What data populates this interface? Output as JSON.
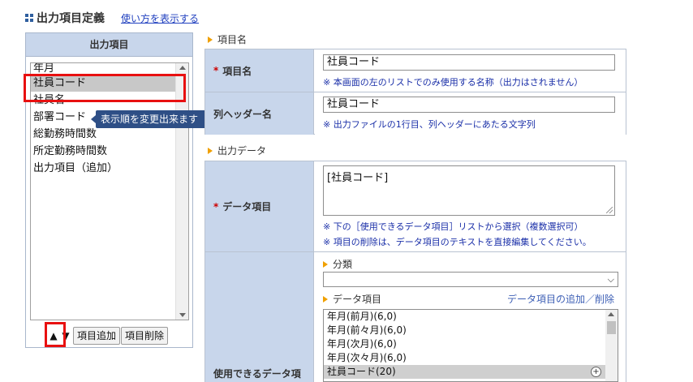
{
  "header": {
    "title": "出力項目定義",
    "help_link": "使い方を表示する"
  },
  "left_panel": {
    "heading": "出力項目",
    "items": [
      {
        "label": "年月"
      },
      {
        "label": "社員コード"
      },
      {
        "label": "社員名"
      },
      {
        "label": "部署コード"
      },
      {
        "label": "総勤務時間数"
      },
      {
        "label": "所定勤務時間数"
      },
      {
        "label": "出力項目（追加）"
      }
    ],
    "selected_index": 1,
    "tooltip": "表示順を変更出来ます",
    "up_arrow": "▲",
    "down_arrow": "▼",
    "add_button": "項目追加",
    "delete_button": "項目削除"
  },
  "section_item_name": {
    "label": "項目名"
  },
  "item_name_row": {
    "required": "*",
    "label": "項目名",
    "value": "社員コード",
    "note": "※ 本画面の左のリストでのみ使用する名称（出力はされません）"
  },
  "column_header_row": {
    "label": "列ヘッダー名",
    "value": "社員コード",
    "note": "※ 出力ファイルの1行目、列ヘッダーにあたる文字列"
  },
  "section_output_data": {
    "label": "出力データ"
  },
  "data_item_row": {
    "required": "*",
    "label": "データ項目",
    "value": "[社員コード]",
    "note1": "※ 下の［使用できるデータ項目］リストから選択（複数選択可）",
    "note2": "※ 項目の削除は、データ項目のテキストを直接編集してください。"
  },
  "available_row": {
    "label": "使用できるデータ項",
    "category_label": "分類",
    "category_value": "",
    "data_items_label": "データ項目",
    "add_delete_link": "データ項目の追加／削除",
    "data_items": [
      {
        "label": "年月(前月)(6,0)"
      },
      {
        "label": "年月(前々月)(6,0)"
      },
      {
        "label": "年月(次月)(6,0)"
      },
      {
        "label": "年月(次々月)(6,0)"
      },
      {
        "label": "社員コード(20)"
      }
    ],
    "selected_data_index": 4,
    "plus_symbol": "+"
  },
  "colors": {
    "header_bg": "#c8d6eb",
    "accent_red": "#e81010",
    "tooltip_bg": "#2e4f86",
    "note_blue": "#1a2fa8",
    "link_blue": "#1f3fbf",
    "marker_orange": "#f0a000"
  },
  "icons": {
    "title_icon": "grid-icon",
    "section_marker": "triangle-right-icon",
    "select_arrow": "chevron-down-icon"
  }
}
